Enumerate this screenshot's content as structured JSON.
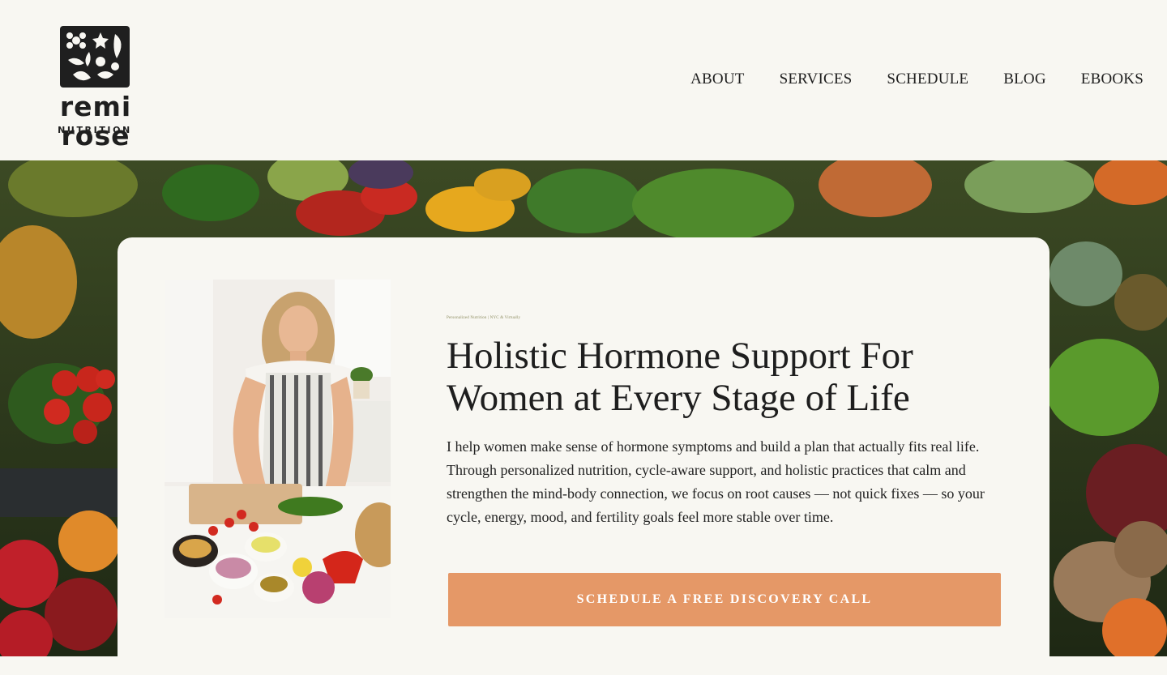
{
  "brand": {
    "name": "remi rose",
    "subtitle": "NUTRITION",
    "logo_icon": "floral-botanical-logo-icon"
  },
  "nav": {
    "items": [
      "ABOUT",
      "SERVICES",
      "SCHEDULE",
      "BLOG",
      "EBOOKS"
    ]
  },
  "hero": {
    "background": "produce-market-photo",
    "photo": "woman-chopping-vegetables-photo",
    "eyebrow": "Personalized Nutrition | NYC & Virtually",
    "headline": "Holistic Hormone Support For Women at Every Stage of Life",
    "body": "I help women make sense of hormone symptoms and build a plan that actually fits real life. Through personalized nutrition, cycle-aware support, and holistic practices that calm and strengthen the mind-body connection, we focus on root causes — not quick fixes — so your cycle, energy, mood, and fertility goals feel more stable over time.",
    "cta_label": "SCHEDULE A FREE DISCOVERY CALL"
  },
  "colors": {
    "background": "#f8f7f2",
    "cta": "#e59867",
    "text": "#1e1e1e"
  }
}
